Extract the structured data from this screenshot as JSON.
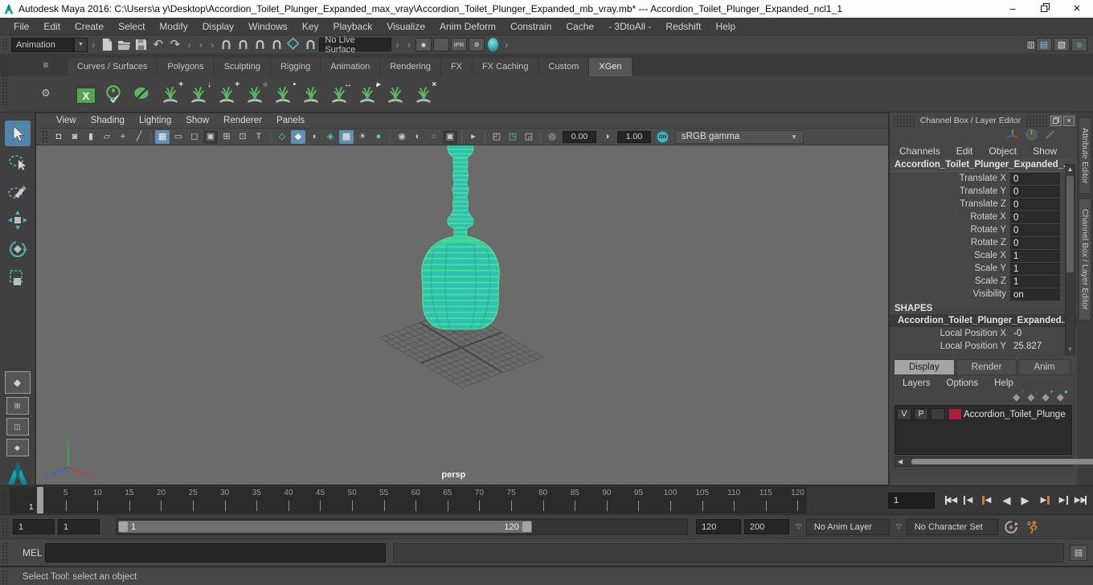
{
  "title_bar": {
    "title": "Autodesk Maya 2016: C:\\Users\\a y\\Desktop\\Accordion_Toilet_Plunger_Expanded_max_vray\\Accordion_Toilet_Plunger_Expanded_mb_vray.mb* --- Accordion_Toilet_Plunger_Expanded_ncl1_1"
  },
  "menu_bar": {
    "items": [
      "File",
      "Edit",
      "Create",
      "Select",
      "Modify",
      "Display",
      "Windows",
      "Key",
      "Playback",
      "Visualize",
      "Anim Deform",
      "Constrain",
      "Cache",
      "- 3DtoAll -",
      "Redshift",
      "Help"
    ]
  },
  "status_line": {
    "menu_set": "Animation",
    "live_surface": "No Live Surface"
  },
  "shelf": {
    "tabs": [
      "Curves / Surfaces",
      "Polygons",
      "Sculpting",
      "Rigging",
      "Animation",
      "Rendering",
      "FX",
      "FX Caching",
      "Custom",
      "XGen"
    ],
    "active_tab": "XGen",
    "xgen_icons": [
      [
        "xgen-create-description-icon",
        "+"
      ],
      [
        "xgen-append-collection-icon",
        "↓"
      ],
      [
        "xgen-add-guide-icon",
        "+"
      ],
      [
        "xgen-toggle-guide-display-icon",
        "○"
      ],
      [
        "xgen-lock-guide-icon",
        "•"
      ],
      [
        "xgen-density-mask-icon",
        ""
      ],
      [
        "xgen-guide-width-icon",
        "↔"
      ],
      [
        "xgen-sculpt-guides-icon",
        "▸"
      ],
      [
        "xgen-select-region-icon",
        ""
      ],
      [
        "xgen-delete-guides-icon",
        "×"
      ]
    ]
  },
  "panel_menu": {
    "items": [
      "View",
      "Shading",
      "Lighting",
      "Show",
      "Renderer",
      "Panels"
    ]
  },
  "viewport_bar": {
    "icons": [
      [
        "select-camera-icon",
        "◘",
        ""
      ],
      [
        "camera-attributes-icon",
        "◙",
        ""
      ],
      [
        "bookmark-icon",
        "▮",
        ""
      ],
      [
        "image-plane-icon",
        "▱",
        ""
      ],
      [
        "pan-zoom-icon",
        "+",
        ""
      ],
      [
        "grease-pencil-icon",
        "╱",
        ""
      ],
      [
        "sep"
      ],
      [
        "grid-icon",
        "▦",
        "active"
      ],
      [
        "film-gate-icon",
        "▭",
        ""
      ],
      [
        "resolution-gate-icon",
        "◻",
        ""
      ],
      [
        "gate-mask-icon",
        "▣",
        "dark"
      ],
      [
        "field-chart-icon",
        "⊞",
        ""
      ],
      [
        "safe-action-icon",
        "⊡",
        ""
      ],
      [
        "safe-title-icon",
        "T",
        ""
      ],
      [
        "sep"
      ],
      [
        "wireframe-icon",
        "◇",
        "teal"
      ],
      [
        "smooth-shade-icon",
        "◆",
        "active"
      ],
      [
        "bounding-box-icon",
        "◖",
        ""
      ],
      [
        "wireframe-on-shaded-icon",
        "◈",
        "teal"
      ],
      [
        "textured-icon",
        "▩",
        "active"
      ],
      [
        "lighting-icon",
        "☀",
        ""
      ],
      [
        "shadows-icon",
        "●",
        "teal"
      ],
      [
        "sep"
      ],
      [
        "occlusion-icon",
        "◉",
        ""
      ],
      [
        "motion-blur-icon",
        "◐",
        ""
      ],
      [
        "multisample-icon",
        "○",
        "teal"
      ],
      [
        "isolate-select-icon",
        "▣",
        "dark"
      ],
      [
        "sep"
      ],
      [
        "pick-cursor-icon",
        "▸",
        ""
      ],
      [
        "sep"
      ],
      [
        "copy-layout-icon",
        "◰",
        ""
      ],
      [
        "paste-layout-icon",
        "◳",
        "teal"
      ],
      [
        "resize-layout-icon",
        "◲",
        ""
      ],
      [
        "sep"
      ]
    ],
    "exposure": "0.00",
    "contrast": "1.00",
    "toggle": "ON",
    "view_transform": "sRGB gamma"
  },
  "viewport": {
    "camera": "persp",
    "axis_x": "x",
    "axis_y": "y",
    "axis_z": "z"
  },
  "channel_box": {
    "header": "Channel Box / Layer Editor",
    "menus": [
      "Channels",
      "Edit",
      "Object",
      "Show"
    ],
    "object_name": "Accordion_Toilet_Plunger_Expanded_...",
    "channels": [
      [
        "Translate X",
        "0"
      ],
      [
        "Translate Y",
        "0"
      ],
      [
        "Translate Z",
        "0"
      ],
      [
        "Rotate X",
        "0"
      ],
      [
        "Rotate Y",
        "0"
      ],
      [
        "Rotate Z",
        "0"
      ],
      [
        "Scale X",
        "1"
      ],
      [
        "Scale Y",
        "1"
      ],
      [
        "Scale Z",
        "1"
      ],
      [
        "Visibility",
        "on"
      ]
    ],
    "shapes_header": "SHAPES",
    "shape_name": "Accordion_Toilet_Plunger_Expanded...",
    "shape_channels": [
      [
        "Local Position X",
        "-0"
      ],
      [
        "Local Position Y",
        "25.827"
      ]
    ]
  },
  "layer_editor": {
    "tabs": [
      "Display",
      "Render",
      "Anim"
    ],
    "active_tab": "Display",
    "menus": [
      "Layers",
      "Options",
      "Help"
    ],
    "layer": {
      "visible": "V",
      "playback": "P",
      "name": "Accordion_Toilet_Plunge"
    },
    "layer_color": "#a81e3e",
    "icon_mods": [
      "↑",
      "↓",
      "+",
      "●"
    ]
  },
  "side_tabs": {
    "attribute_editor": "Attribute Editor",
    "channel_box": "Channel Box / Layer Editor"
  },
  "time_slider": {
    "ticks": [
      5,
      10,
      15,
      20,
      25,
      30,
      35,
      40,
      45,
      50,
      55,
      60,
      65,
      70,
      75,
      80,
      85,
      90,
      95,
      100,
      105,
      110,
      115,
      120
    ],
    "current_frame": "1",
    "frame_field": "1",
    "playback": [
      [
        "go-to-start-button",
        "◀◀",
        "bar-l",
        ""
      ],
      [
        "step-back-key-button",
        "◀",
        "bar-l",
        ""
      ],
      [
        "step-back-frame-button",
        "◀",
        "bar-l orange",
        ""
      ],
      [
        "play-backwards-button",
        "◀",
        "",
        "big"
      ],
      [
        "play-forwards-button",
        "▶",
        "",
        "big"
      ],
      [
        "step-forward-frame-button",
        "▶",
        "bar-r orange",
        ""
      ],
      [
        "step-forward-key-button",
        "▶",
        "bar-r",
        ""
      ],
      [
        "go-to-end-button",
        "▶▶",
        "bar-r",
        ""
      ]
    ]
  },
  "range_slider": {
    "playback_start": "1",
    "anim_start": "1",
    "range_start_label": "1",
    "range_end_label": "120",
    "playback_end": "120",
    "anim_end": "200",
    "anim_layer": "No Anim Layer",
    "character_set": "No Character Set"
  },
  "command_line": {
    "label": "MEL"
  },
  "help_line": {
    "text": "Select Tool: select an object"
  },
  "glyphs": {
    "minimize": "–",
    "close": "×",
    "menu": "≡",
    "gear": "⚙",
    "undo": "↶",
    "redo": "↷",
    "dropdown": "▼",
    "small_dropdown": "▽",
    "up": "▲",
    "down": "▼",
    "left": "◀",
    "right": "▶",
    "ipr": "IPR",
    "x": "X",
    "eye": "◉",
    "sep_arrow": "›",
    "exposure_icon": "◎",
    "contrast_icon": "◑",
    "script_icon": "▤",
    "diamond": "◆",
    "quad": "⊞",
    "split": "◫"
  },
  "colors": {
    "accent_blue": "#5285a6",
    "wire_green": "#49e287",
    "fill_teal": "#2fbdb9",
    "layer_red": "#a81e3e",
    "orange": "#cf7a30"
  }
}
